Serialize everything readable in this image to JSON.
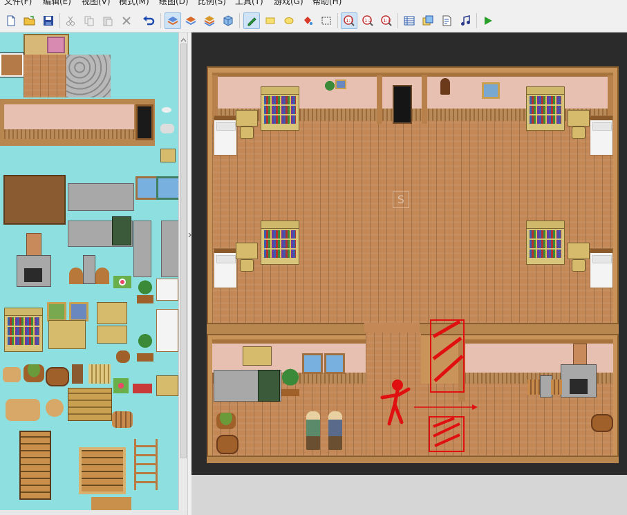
{
  "menu": {
    "items": [
      "文件(F)",
      "编辑(E)",
      "视图(V)",
      "模式(M)",
      "绘图(D)",
      "比例(S)",
      "工具(T)",
      "游戏(G)",
      "帮助(H)"
    ]
  },
  "toolbar": {
    "buttons": [
      {
        "name": "new-project-button",
        "icon": "new-file-icon"
      },
      {
        "name": "open-project-button",
        "icon": "open-folder-icon"
      },
      {
        "name": "save-project-button",
        "icon": "save-disk-icon"
      },
      {
        "name": "cut-button",
        "icon": "scissors-icon"
      },
      {
        "name": "copy-button",
        "icon": "copy-icon"
      },
      {
        "name": "paste-button",
        "icon": "paste-icon"
      },
      {
        "name": "delete-button",
        "icon": "delete-x-icon"
      },
      {
        "name": "undo-button",
        "icon": "undo-arrow-icon"
      },
      {
        "name": "layer-1-button",
        "icon": "layer-1-icon",
        "active": true
      },
      {
        "name": "layer-2-button",
        "icon": "layer-2-icon"
      },
      {
        "name": "layer-3-button",
        "icon": "layer-3-icon"
      },
      {
        "name": "event-layer-button",
        "icon": "event-cube-icon"
      },
      {
        "name": "pencil-tool-button",
        "icon": "pencil-icon",
        "active": true
      },
      {
        "name": "rectangle-tool-button",
        "icon": "rectangle-icon"
      },
      {
        "name": "ellipse-tool-button",
        "icon": "ellipse-icon"
      },
      {
        "name": "fill-tool-button",
        "icon": "fill-bucket-icon"
      },
      {
        "name": "select-tool-button",
        "icon": "select-marquee-icon"
      },
      {
        "name": "zoom-1-1-button",
        "icon": "zoom-1-1-icon",
        "active": true
      },
      {
        "name": "zoom-1-2-button",
        "icon": "zoom-1-2-icon"
      },
      {
        "name": "zoom-1-4-button",
        "icon": "zoom-1-4-icon"
      },
      {
        "name": "database-button",
        "icon": "database-icon"
      },
      {
        "name": "materials-button",
        "icon": "materials-icon"
      },
      {
        "name": "script-editor-button",
        "icon": "script-icon"
      },
      {
        "name": "sound-test-button",
        "icon": "music-note-icon"
      },
      {
        "name": "playtest-button",
        "icon": "play-icon"
      }
    ]
  },
  "colors": {
    "palette_bg": "#8ee0e0",
    "map_bg": "#2b2b2b",
    "floor": "#c38856",
    "wall": "#e8c0b2",
    "annotation_red": "#e01010",
    "play_green": "#2aa02a"
  },
  "map": {
    "start_marker_label": "S"
  }
}
